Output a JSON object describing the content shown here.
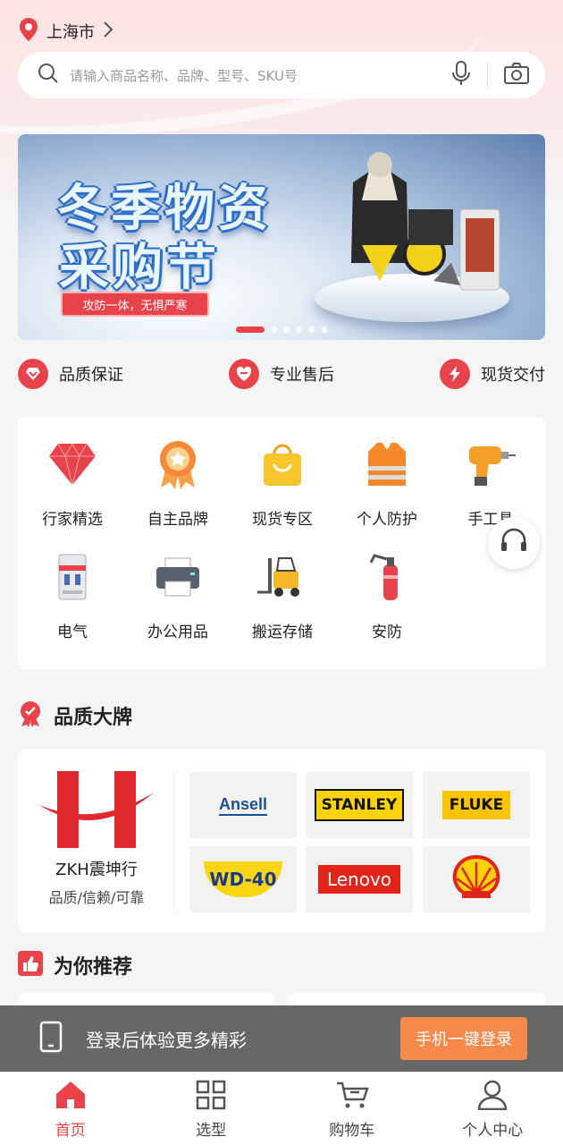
{
  "header": {
    "city": "上海市",
    "search_placeholder": "请输入商品名称、品牌、型号、SKU号"
  },
  "banner": {
    "title_line1": "冬季物资",
    "title_line2": "采购节",
    "slogan": "攻防一体，无惧严寒",
    "slide_count": 6,
    "active_slide": 1
  },
  "features": [
    {
      "label": "品质保证",
      "icon": "heart-diamond-icon"
    },
    {
      "label": "专业售后",
      "icon": "handshake-heart-icon"
    },
    {
      "label": "现货交付",
      "icon": "lightning-icon"
    }
  ],
  "categories": [
    {
      "label": "行家精选",
      "icon": "diamond-icon"
    },
    {
      "label": "自主品牌",
      "icon": "medal-icon"
    },
    {
      "label": "现货专区",
      "icon": "shopping-bag-icon"
    },
    {
      "label": "个人防护",
      "icon": "safety-vest-icon"
    },
    {
      "label": "手工具",
      "icon": "drill-icon"
    },
    {
      "label": "电气",
      "icon": "circuit-breaker-icon"
    },
    {
      "label": "办公用品",
      "icon": "printer-icon"
    },
    {
      "label": "搬运存储",
      "icon": "forklift-icon"
    },
    {
      "label": "安防",
      "icon": "fire-extinguisher-icon"
    }
  ],
  "brands_section": {
    "title": "品质大牌",
    "zkh_name": "ZKH震坤行",
    "zkh_tagline": "品质/信赖/可靠",
    "brands": [
      "Ansell",
      "STANLEY",
      "FLUKE",
      "WD-40",
      "Lenovo",
      "Shell"
    ]
  },
  "recommend_section": {
    "title": "为你推荐"
  },
  "login_bar": {
    "message": "登录后体验更多精彩",
    "button": "手机一键登录"
  },
  "tabbar": [
    {
      "label": "首页",
      "icon": "home-icon",
      "active": true
    },
    {
      "label": "选型",
      "icon": "grid-icon",
      "active": false
    },
    {
      "label": "购物车",
      "icon": "cart-icon",
      "active": false
    },
    {
      "label": "个人中心",
      "icon": "user-icon",
      "active": false
    }
  ],
  "colors": {
    "accent": "#e8434a",
    "login_button": "#f58a4b"
  }
}
